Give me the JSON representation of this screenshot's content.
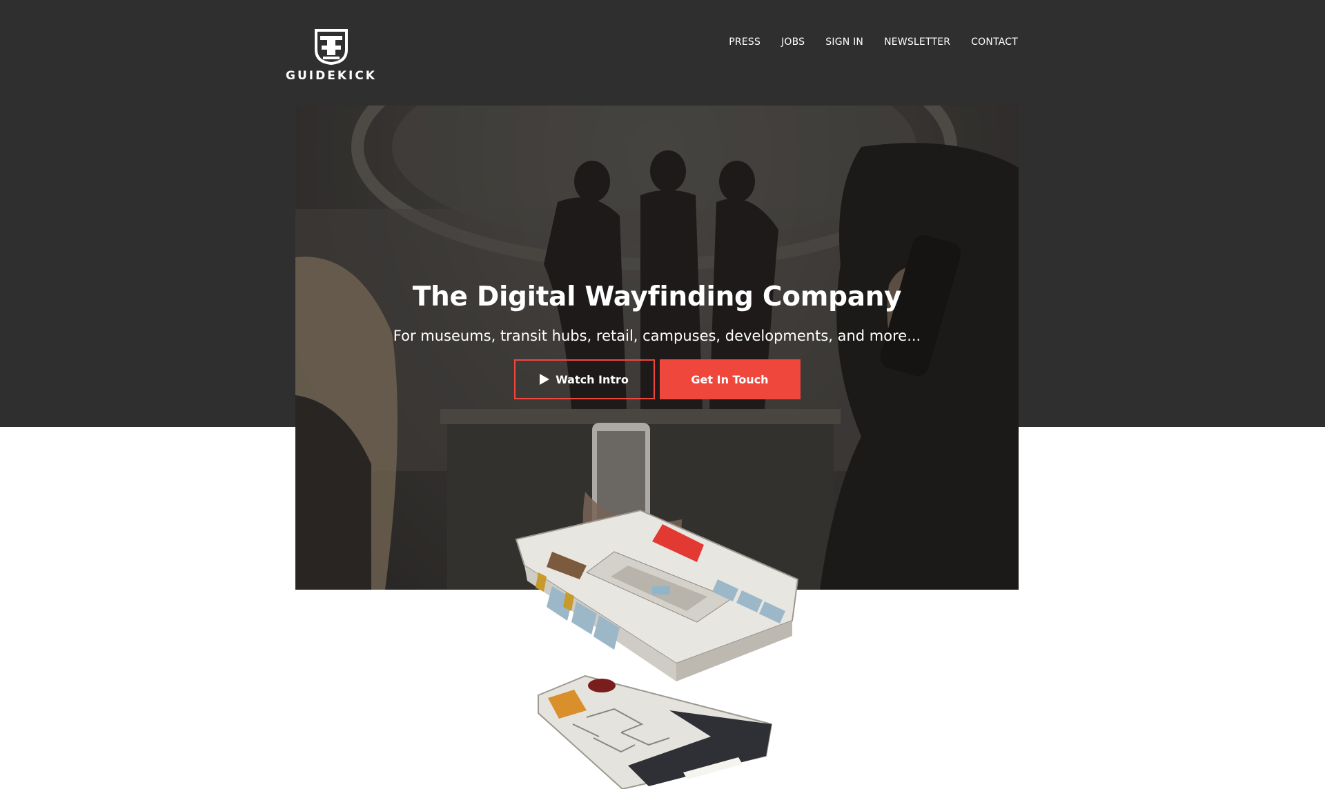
{
  "brand": {
    "name": "GUIDEKICK",
    "accent_color": "#f0473d",
    "header_bg": "#2f2f2f"
  },
  "nav": {
    "items": [
      {
        "label": "PRESS"
      },
      {
        "label": "JOBS"
      },
      {
        "label": "SIGN IN"
      },
      {
        "label": "NEWSLETTER"
      },
      {
        "label": "CONTACT"
      }
    ]
  },
  "hero": {
    "title": "The Digital Wayfinding Company",
    "subtitle": "For museums, transit hubs, retail, campuses, developments, and more...",
    "watch_button": {
      "label": "Watch Intro",
      "icon": "play-icon"
    },
    "contact_button": {
      "label": "Get In Touch"
    }
  },
  "images": {
    "hero_photo": "museum-sculpture-visitors-photo",
    "floorplan": "3d-museum-floorplan-illustration"
  }
}
